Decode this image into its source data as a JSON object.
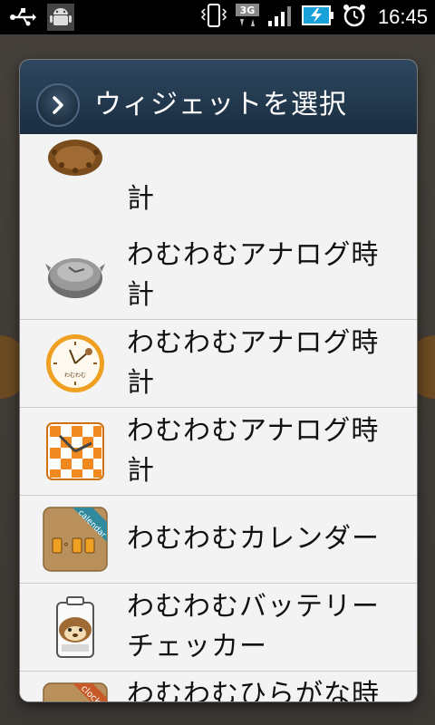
{
  "status_bar": {
    "time": "16:45",
    "icons": [
      "usb-icon",
      "android-icon",
      "vibrate-icon",
      "3g-icon",
      "signal-icon",
      "battery-charging-icon",
      "alarm-icon"
    ]
  },
  "dialog": {
    "title": "ウィジェットを選択",
    "items": [
      {
        "label": "計",
        "icon": "hedgehog-clock-icon"
      },
      {
        "label": "わむわむアナログ時計",
        "icon": "gray-sheep-clock-icon"
      },
      {
        "label": "わむわむアナログ時計",
        "icon": "orange-round-clock-icon"
      },
      {
        "label": "わむわむアナログ時計",
        "icon": "orange-check-clock-icon"
      },
      {
        "label": "わむわむカレンダー",
        "icon": "calendar-widget-icon",
        "badge": "calendar"
      },
      {
        "label": "わむわむバッテリーチェッカー",
        "icon": "battery-checker-icon"
      },
      {
        "label": "わむわむひらがな時計",
        "icon": "hiragana-clock-icon",
        "badge": "clock"
      }
    ]
  },
  "colors": {
    "header_top": "#2e4860",
    "header_bottom": "#1a2d40",
    "list_bg": "#f3f3f3",
    "divider": "#c9c9c9",
    "accent_orange": "#f0a020"
  }
}
